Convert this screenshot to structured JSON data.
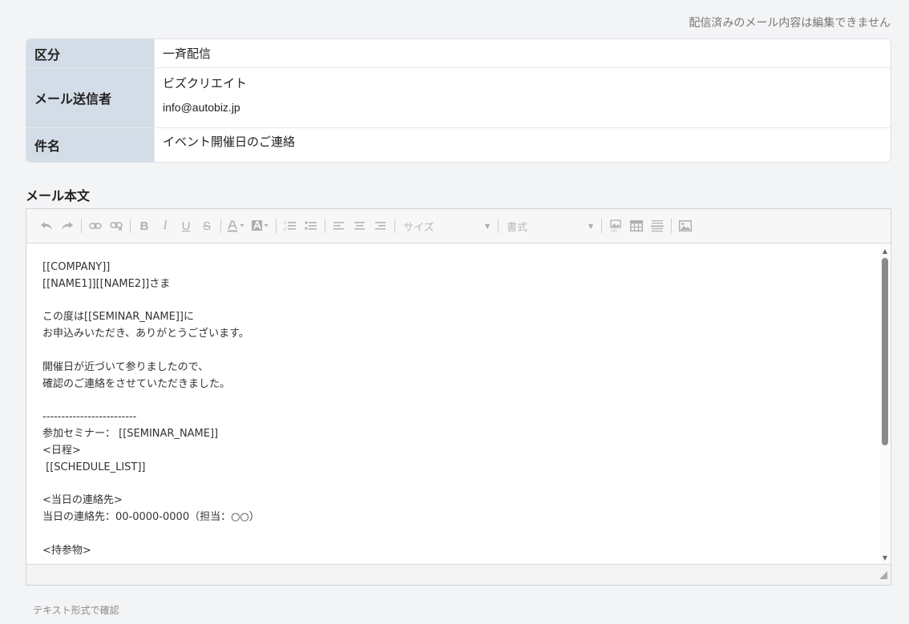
{
  "notice": "配信済みのメール内容は編集できません",
  "info": {
    "kubun_label": "区分",
    "kubun_value": "一斉配信",
    "sender_label": "メール送信者",
    "sender_name": "ビズクリエイト",
    "sender_email": "info@autobiz.jp",
    "subject_label": "件名",
    "subject_value": "イベント開催日のご連絡"
  },
  "body_section_title": "メール本文",
  "toolbar": {
    "size_placeholder": "サイズ",
    "format_placeholder": "書式"
  },
  "body_text": "[[COMPANY]]\n[[NAME1]][[NAME2]]さま\n\nこの度は[[SEMINAR_NAME]]に\nお申込みいただき、ありがとうございます。\n\n開催日が近づいて参りましたので、\n確認のご連絡をさせていただきました。\n\n-------------------------\n参加セミナー： [[SEMINAR_NAME]]\n<日程>\n [[SCHEDULE_LIST]]\n\n<当日の連絡先>\n当日の連絡先：00-0000-0000（担当：○○）\n\n<持参物>",
  "text_confirm_link": "テキスト形式で確認"
}
